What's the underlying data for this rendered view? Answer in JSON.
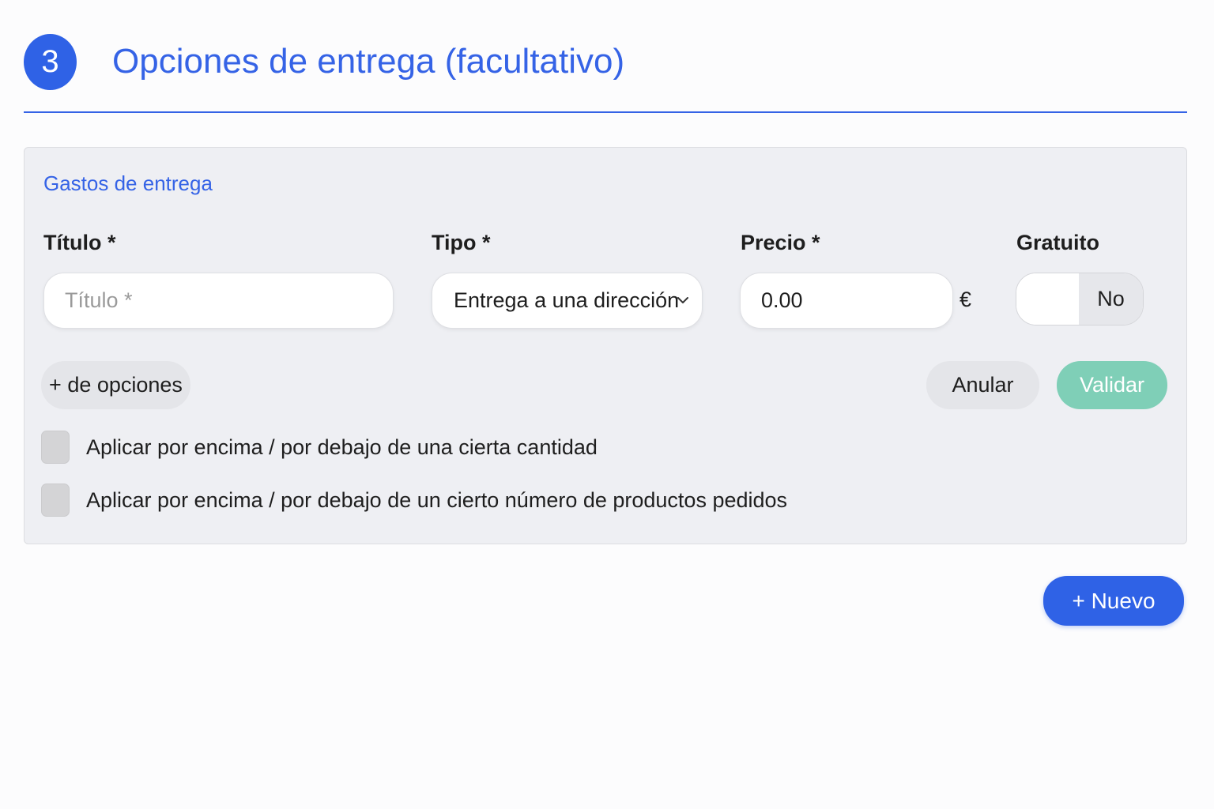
{
  "header": {
    "step_number": "3",
    "title": "Opciones de entrega (facultativo)"
  },
  "panel": {
    "section_title": "Gastos de entrega",
    "labels": {
      "title": "Título *",
      "type": "Tipo *",
      "price": "Precio *",
      "free": "Gratuito"
    },
    "title_input": {
      "value": "",
      "placeholder": "Título *"
    },
    "type_select": {
      "selected": "Entrega a una dirección",
      "icon": "chevron-down-icon"
    },
    "price_input": {
      "value": "0.00",
      "currency": "€"
    },
    "free_toggle": {
      "state_label": "No",
      "on": false
    },
    "buttons": {
      "more_options": "+ de opciones",
      "cancel": "Anular",
      "validate": "Validar"
    },
    "checkboxes": [
      {
        "label": "Aplicar por encima / por debajo de una cierta cantidad",
        "checked": false
      },
      {
        "label": "Aplicar por encima / por debajo de un cierto número de productos pedidos",
        "checked": false
      }
    ]
  },
  "footer": {
    "new_button": "+ Nuevo"
  },
  "colors": {
    "accent": "#2f62e6",
    "validate": "#7fcfb7",
    "panel_bg": "#eeeff3"
  }
}
